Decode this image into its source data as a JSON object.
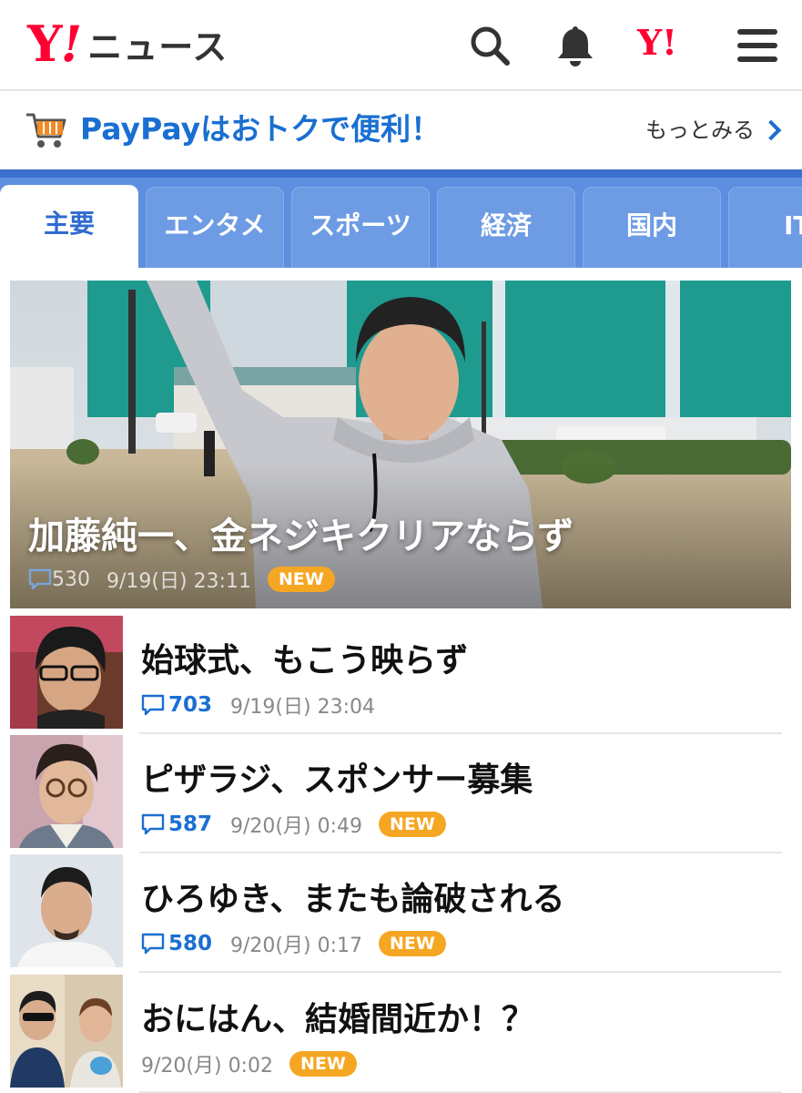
{
  "header": {
    "logo_y": "Y",
    "logo_excl": "!",
    "logo_news": "ニュース",
    "mini_logo": "Y!",
    "icons": [
      "search-icon",
      "bell-icon",
      "yahoo-logo-icon",
      "menu-icon"
    ]
  },
  "promo": {
    "text": "PayPayはおトクで便利！",
    "more": "もっとみる",
    "icon": "cart-icon"
  },
  "tabs": [
    {
      "label": "主要",
      "active": true
    },
    {
      "label": "エンタメ",
      "active": false
    },
    {
      "label": "スポーツ",
      "active": false
    },
    {
      "label": "経済",
      "active": false
    },
    {
      "label": "国内",
      "active": false
    },
    {
      "label": "IT",
      "active": false
    }
  ],
  "hero": {
    "title": "加藤純一、金ネジキクリアならず",
    "comments": "530",
    "datetime": "9/19(日) 23:11",
    "badge": "NEW"
  },
  "articles": [
    {
      "title": "始球式、もこう映らず",
      "comments": "703",
      "datetime": "9/19(日) 23:04",
      "badge": ""
    },
    {
      "title": "ピザラジ、スポンサー募集",
      "comments": "587",
      "datetime": "9/20(月) 0:49",
      "badge": "NEW"
    },
    {
      "title": "ひろゆき、またも論破される",
      "comments": "580",
      "datetime": "9/20(月) 0:17",
      "badge": "NEW"
    },
    {
      "title": "おにはん、結婚間近か！？",
      "comments": "",
      "datetime": "9/20(月) 0:02",
      "badge": "NEW"
    }
  ],
  "colors": {
    "brand_red": "#ff0033",
    "link_blue": "#1a6fd1",
    "tab_blue": "#5e8ee0",
    "new_badge": "#f5a623"
  }
}
